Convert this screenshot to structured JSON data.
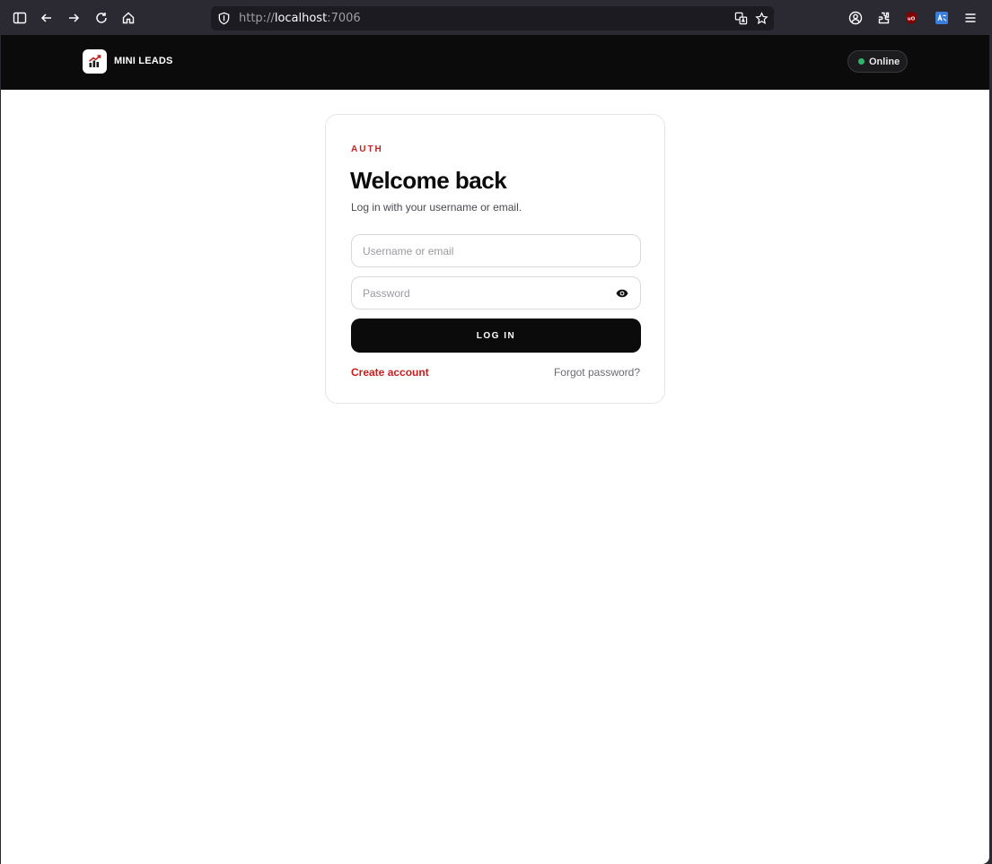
{
  "browser": {
    "url_prefix": "http://",
    "url_host": "localhost",
    "url_suffix": ":7006"
  },
  "header": {
    "brand": "MINI LEADS",
    "status": "Online",
    "status_color": "#2fb56b"
  },
  "login": {
    "eyebrow": "AUTH",
    "title": "Welcome back",
    "subtitle": "Log in with your username or email.",
    "username_placeholder": "Username or email",
    "username_value": "",
    "password_placeholder": "Password",
    "password_value": "",
    "submit_label": "LOG IN",
    "create_account": "Create account",
    "forgot_password": "Forgot password?"
  },
  "colors": {
    "accent": "#c81e1e",
    "header_bg": "#0b0b0c",
    "button_bg": "#0b0b0c"
  },
  "icons": {
    "logo": "bar-chart-arrow-icon",
    "password_toggle": "eye-icon"
  }
}
